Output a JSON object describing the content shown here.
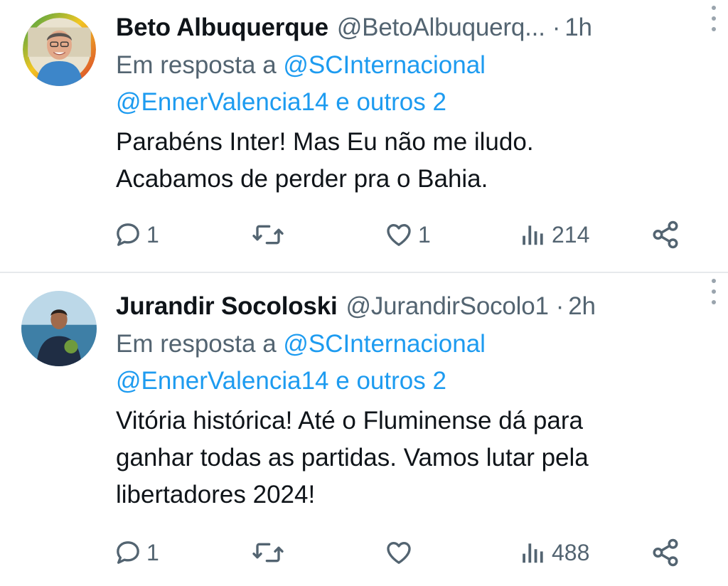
{
  "tweets": [
    {
      "name": "Beto Albuquerque",
      "handle": "@BetoAlbuquerq...",
      "dot": "·",
      "time": "1h",
      "reply_prefix": "Em resposta a",
      "reply_to_1": "@SCInternacional",
      "reply_to_2": "@EnnerValencia14",
      "reply_others": "e outros 2",
      "text_lines": [
        "Parabéns Inter! Mas Eu não me iludo.",
        "Acabamos de perder pra o Bahia."
      ],
      "reply_count": "1",
      "retweet_count": "",
      "like_count": "1",
      "views_count": "214"
    },
    {
      "name": "Jurandir Socoloski",
      "handle": "@JurandirSocolo1",
      "dot": "·",
      "time": "2h",
      "reply_prefix": "Em resposta a",
      "reply_to_1": "@SCInternacional",
      "reply_to_2": "@EnnerValencia14",
      "reply_others": "e outros 2",
      "text_lines": [
        "Vitória histórica! Até o Fluminense dá para",
        "ganhar todas as partidas. Vamos lutar pela",
        "libertadores 2024!"
      ],
      "reply_count": "1",
      "retweet_count": "",
      "like_count": "",
      "views_count": "488"
    }
  ],
  "icons": {
    "reply": "reply-icon",
    "retweet": "retweet-icon",
    "like": "heart-icon",
    "views": "views-icon",
    "share": "share-icon",
    "more": "more-vertical-icon"
  },
  "colors": {
    "text": "#0f1419",
    "secondary": "#536471",
    "link": "#1d9bf0",
    "divider": "#e6e9ec"
  }
}
